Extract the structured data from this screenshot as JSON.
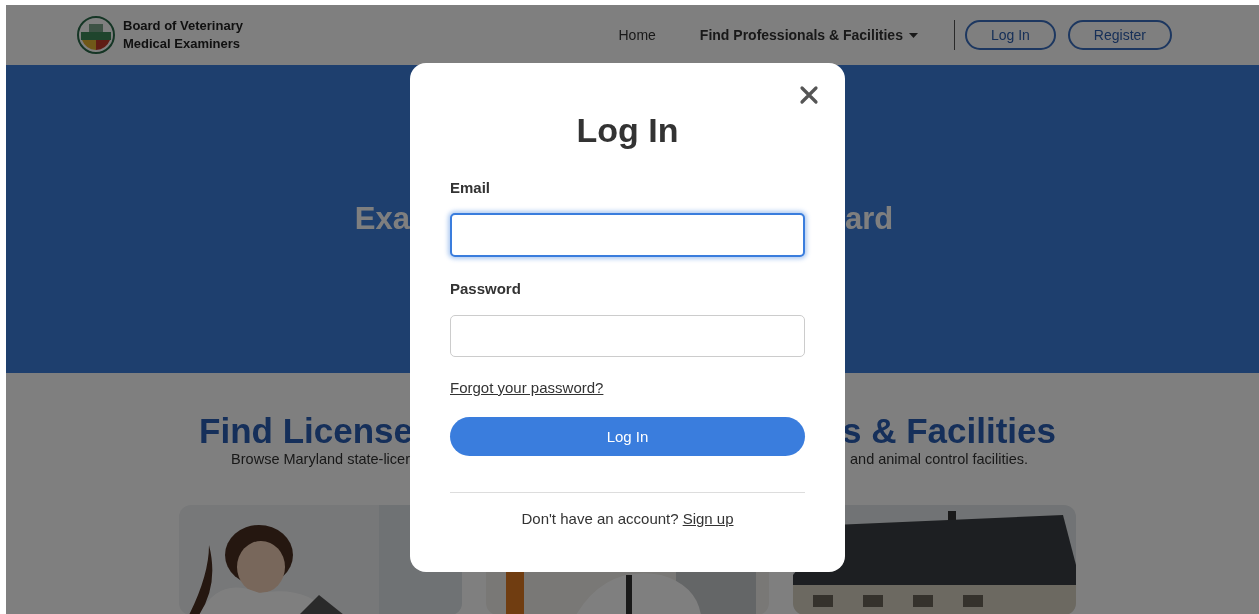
{
  "header": {
    "title_lines": [
      "Board of Veterinary",
      "Medical Examiners"
    ],
    "nav": [
      {
        "label": "Home",
        "kind": "link"
      },
      {
        "label": "Find Professionals & Facilities",
        "kind": "dropdown"
      },
      {
        "label": "Log In",
        "kind": "outline"
      },
      {
        "label": "Register",
        "kind": "outline"
      }
    ]
  },
  "hero": {
    "title_left": "Exa",
    "title_right": "ard"
  },
  "section": {
    "heading_left": "Find License",
    "heading_right": "s & Facilities",
    "subtitle_left": "Browse Maryland state-licer",
    "subtitle_right": "and animal control facilities."
  },
  "modal": {
    "title": "Log In",
    "fields": [
      {
        "label": "Email",
        "focused": true
      },
      {
        "label": "Password",
        "focused": false
      }
    ],
    "forgot_link": "Forgot your password?",
    "submit": "Log In",
    "footer_text": "Don't have an account?",
    "footer_link": "Sign up"
  }
}
